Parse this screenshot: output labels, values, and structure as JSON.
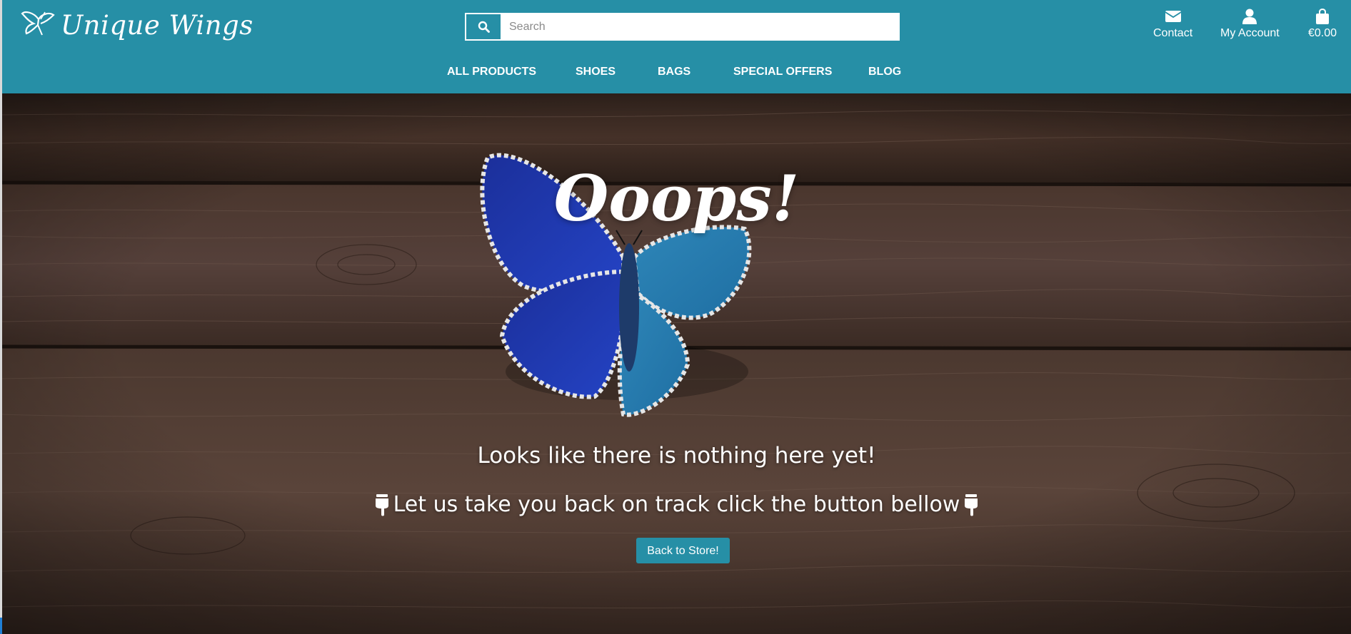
{
  "header": {
    "brand_name": "Unique Wings",
    "search": {
      "placeholder": "Search",
      "value": ""
    },
    "account_links": {
      "contact_label": "Contact",
      "account_label": "My Account",
      "bag_total": "€0.00"
    },
    "nav": [
      {
        "label": "ALL PRODUCTS"
      },
      {
        "label": "SHOES"
      },
      {
        "label": "BAGS"
      },
      {
        "label": "SPECIAL OFFERS"
      },
      {
        "label": "BLOG"
      }
    ]
  },
  "hero": {
    "headline": "Ooops!",
    "message_primary": "Looks like there is nothing here yet!",
    "message_secondary": "Let us take you back on track click the button bellow",
    "back_button_label": "Back to Store!"
  },
  "colors": {
    "brand_teal": "#268fa6",
    "text_white": "#ffffff",
    "wood_brown": "#3c2a22"
  },
  "icons": {
    "brand": "butterfly-icon",
    "search": "search-icon",
    "contact": "envelope-icon",
    "account": "user-icon",
    "bag": "shopping-bag-icon",
    "pointer": "hand-pointing-down-icon"
  }
}
